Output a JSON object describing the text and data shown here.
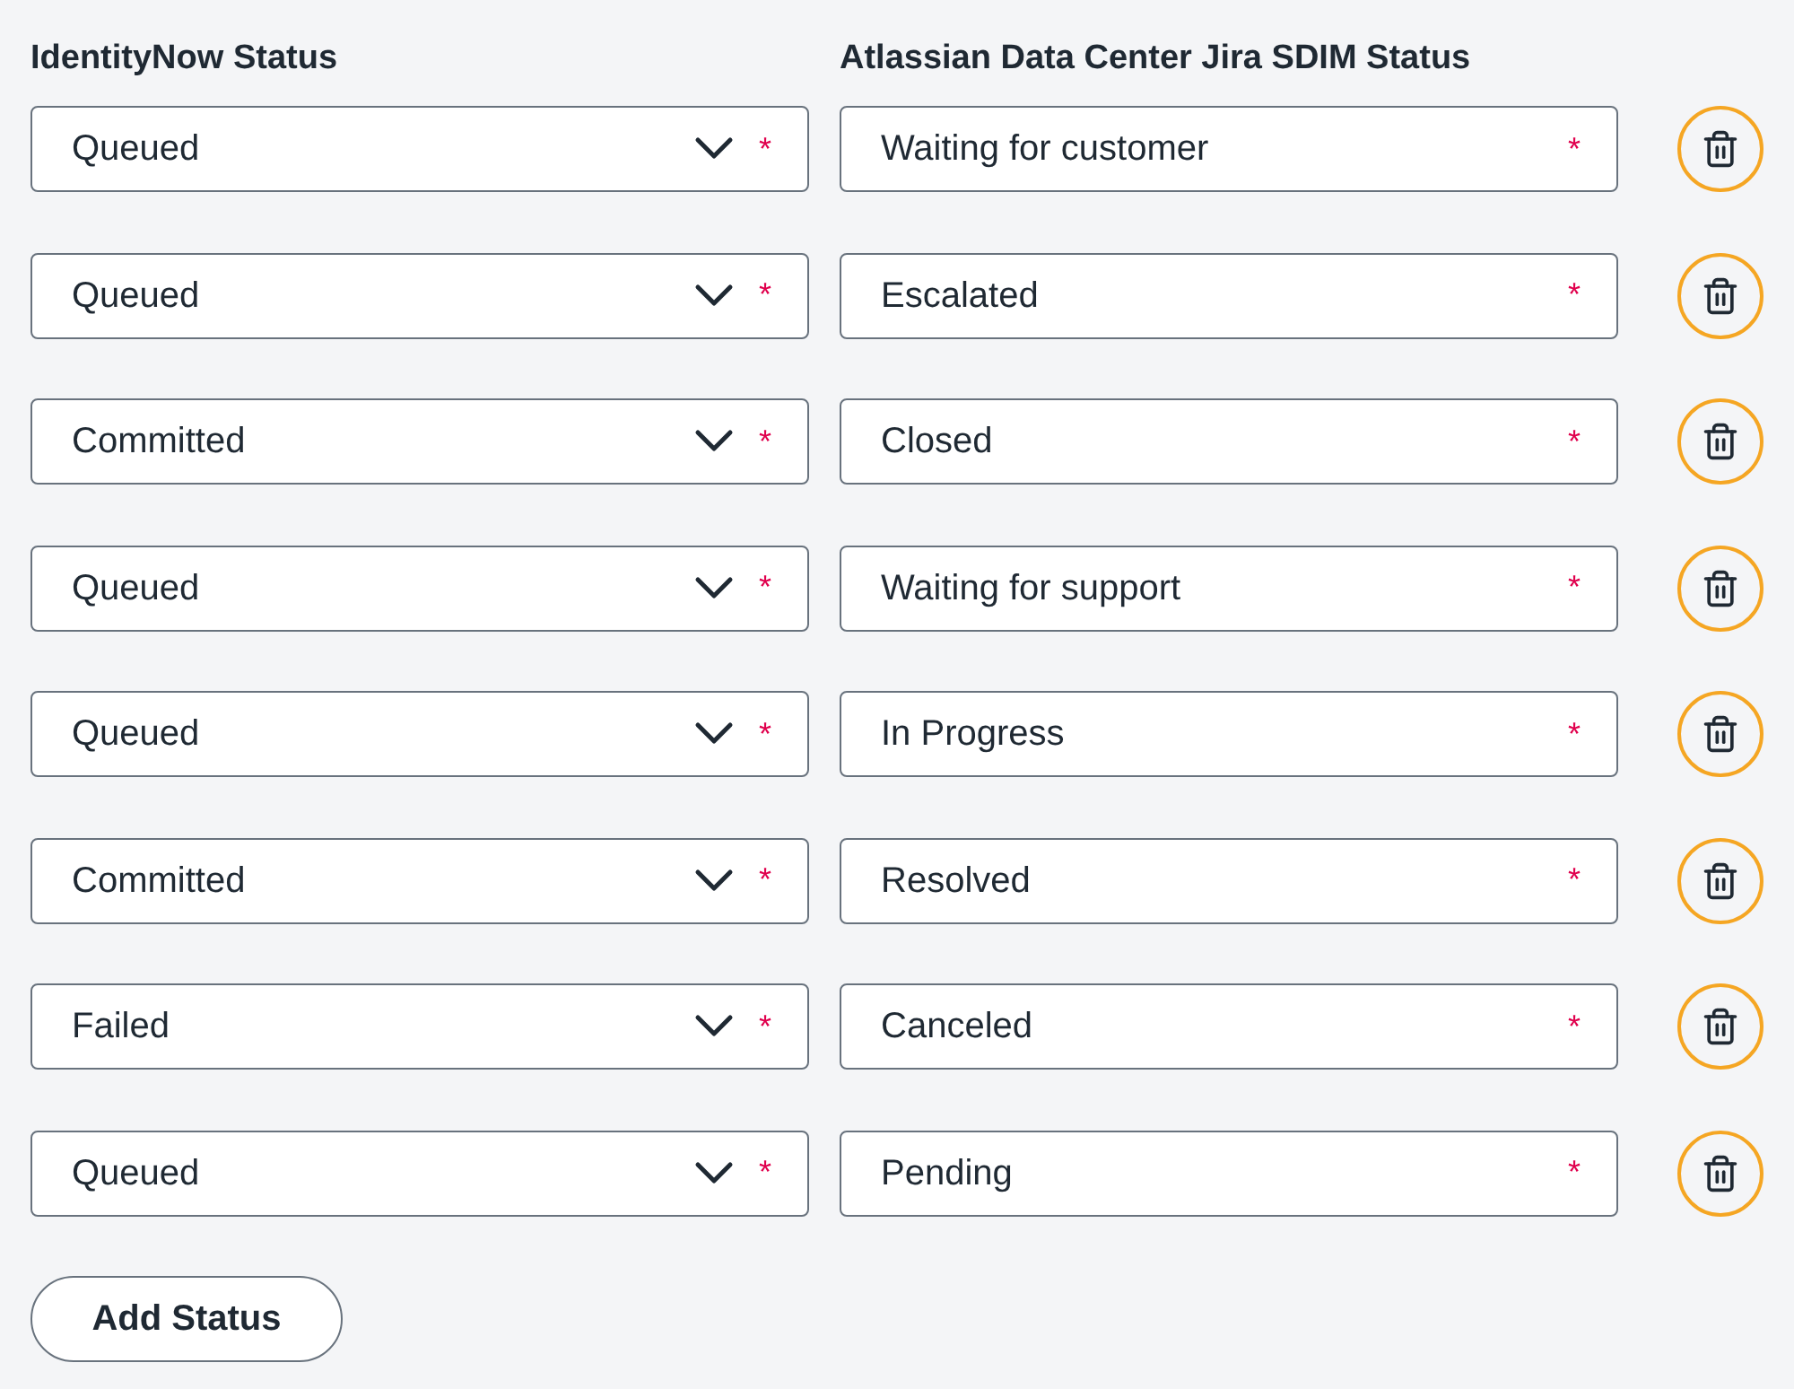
{
  "headers": [
    "IdentityNow Status",
    "Atlassian Data Center Jira SDIM Status"
  ],
  "rows": [
    {
      "identitynow_status": {
        "value": "Queued",
        "required_mark": "*"
      },
      "jira_status": {
        "value": "Waiting for customer",
        "required_mark": "*"
      }
    },
    {
      "identitynow_status": {
        "value": "Queued",
        "required_mark": "*"
      },
      "jira_status": {
        "value": "Escalated",
        "required_mark": "*"
      }
    },
    {
      "identitynow_status": {
        "value": "Committed",
        "required_mark": "*"
      },
      "jira_status": {
        "value": "Closed",
        "required_mark": "*"
      }
    },
    {
      "identitynow_status": {
        "value": "Queued",
        "required_mark": "*"
      },
      "jira_status": {
        "value": "Waiting for support",
        "required_mark": "*"
      }
    },
    {
      "identitynow_status": {
        "value": "Queued",
        "required_mark": "*"
      },
      "jira_status": {
        "value": "In Progress",
        "required_mark": "*"
      }
    },
    {
      "identitynow_status": {
        "value": "Committed",
        "required_mark": "*"
      },
      "jira_status": {
        "value": "Resolved",
        "required_mark": "*"
      }
    },
    {
      "identitynow_status": {
        "value": "Failed",
        "required_mark": "*"
      },
      "jira_status": {
        "value": "Canceled",
        "required_mark": "*"
      }
    },
    {
      "identitynow_status": {
        "value": "Queued",
        "required_mark": "*"
      },
      "jira_status": {
        "value": "Pending",
        "required_mark": "*"
      }
    }
  ],
  "add_button": "Add Status"
}
